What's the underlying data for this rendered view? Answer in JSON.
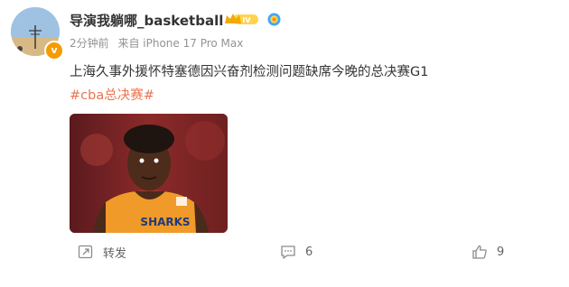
{
  "user": {
    "name": "导演我躺哪_basketball",
    "level_badge": "IV",
    "avatar_badge": "v"
  },
  "meta": {
    "time": "2分钟前",
    "source": "来自 iPhone 17 Pro Max"
  },
  "post": {
    "text": "上海久事外援怀特塞德因兴奋剂检测问题缺席今晚的总决赛G1",
    "hashtag": "#cba总决赛#",
    "image_alt": "jersey-text",
    "jersey_text": "SHARKS"
  },
  "actions": {
    "share_label": "转发",
    "comment_count": "6",
    "like_count": "9"
  },
  "colors": {
    "hashtag": "#eb7350",
    "meta": "#939393",
    "badge_orange": "#f59b00",
    "verify_blue": "#3fa7ff"
  },
  "icons": [
    "share-icon",
    "comment-icon",
    "like-icon",
    "crown-icon",
    "verified-icon"
  ]
}
